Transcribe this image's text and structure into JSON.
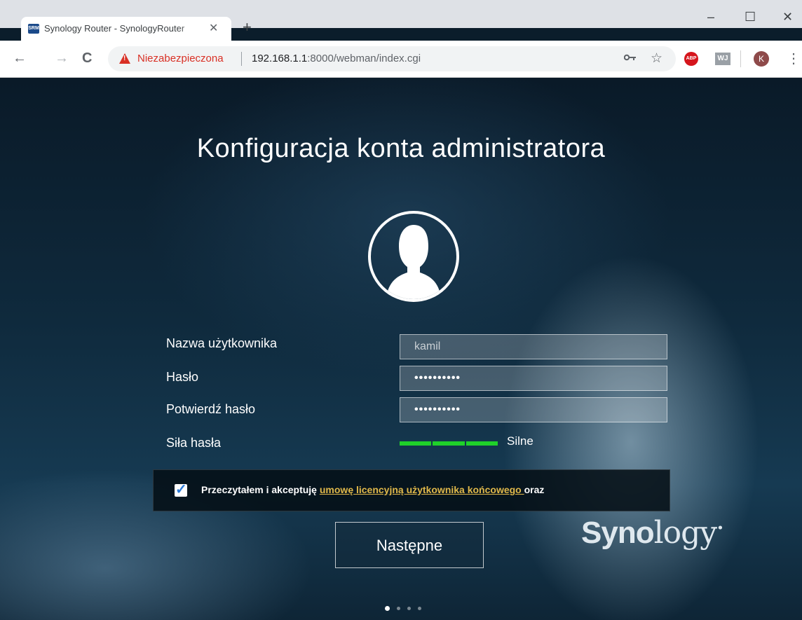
{
  "browser": {
    "tab_favicon": "SRM",
    "tab_title": "Synology Router - SynologyRouter",
    "tab_close": "✕",
    "new_tab": "+",
    "window_minimize": "–",
    "window_maximize": "☐",
    "window_close": "✕",
    "back": "←",
    "forward": "→",
    "reload": "C",
    "insecure_label": "Niezabezpieczona",
    "url_host": "192.168.1.1",
    "url_path": ":8000/webman/index.cgi",
    "abp_label": "ABP",
    "wj_label": "WJ",
    "profile_initial": "K",
    "menu": "⋮"
  },
  "page": {
    "title": "Konfiguracja konta administratora",
    "fields": {
      "username_label": "Nazwa użytkownika",
      "username_value": "kamil",
      "password_label": "Hasło",
      "password_value": "••••••••••",
      "confirm_label": "Potwierdź hasło",
      "confirm_value": "••••••••••",
      "strength_label": "Siła hasła",
      "strength_value": "Silne",
      "strength_level": 1.0
    },
    "eula": {
      "checked": true,
      "text_before": "Przeczytałem i akceptuję ",
      "link": "umowę licencyjną użytkownika końcowego ",
      "text_after": "oraz"
    },
    "next_button": "Następne",
    "logo_bold": "Syno",
    "logo_rest": "logy",
    "logo_mark": "•"
  },
  "colors": {
    "accent_green": "#1fd12a",
    "link_gold": "#e0b84a",
    "warning_red": "#d93025",
    "checkbox_blue": "#2a7ad8"
  }
}
